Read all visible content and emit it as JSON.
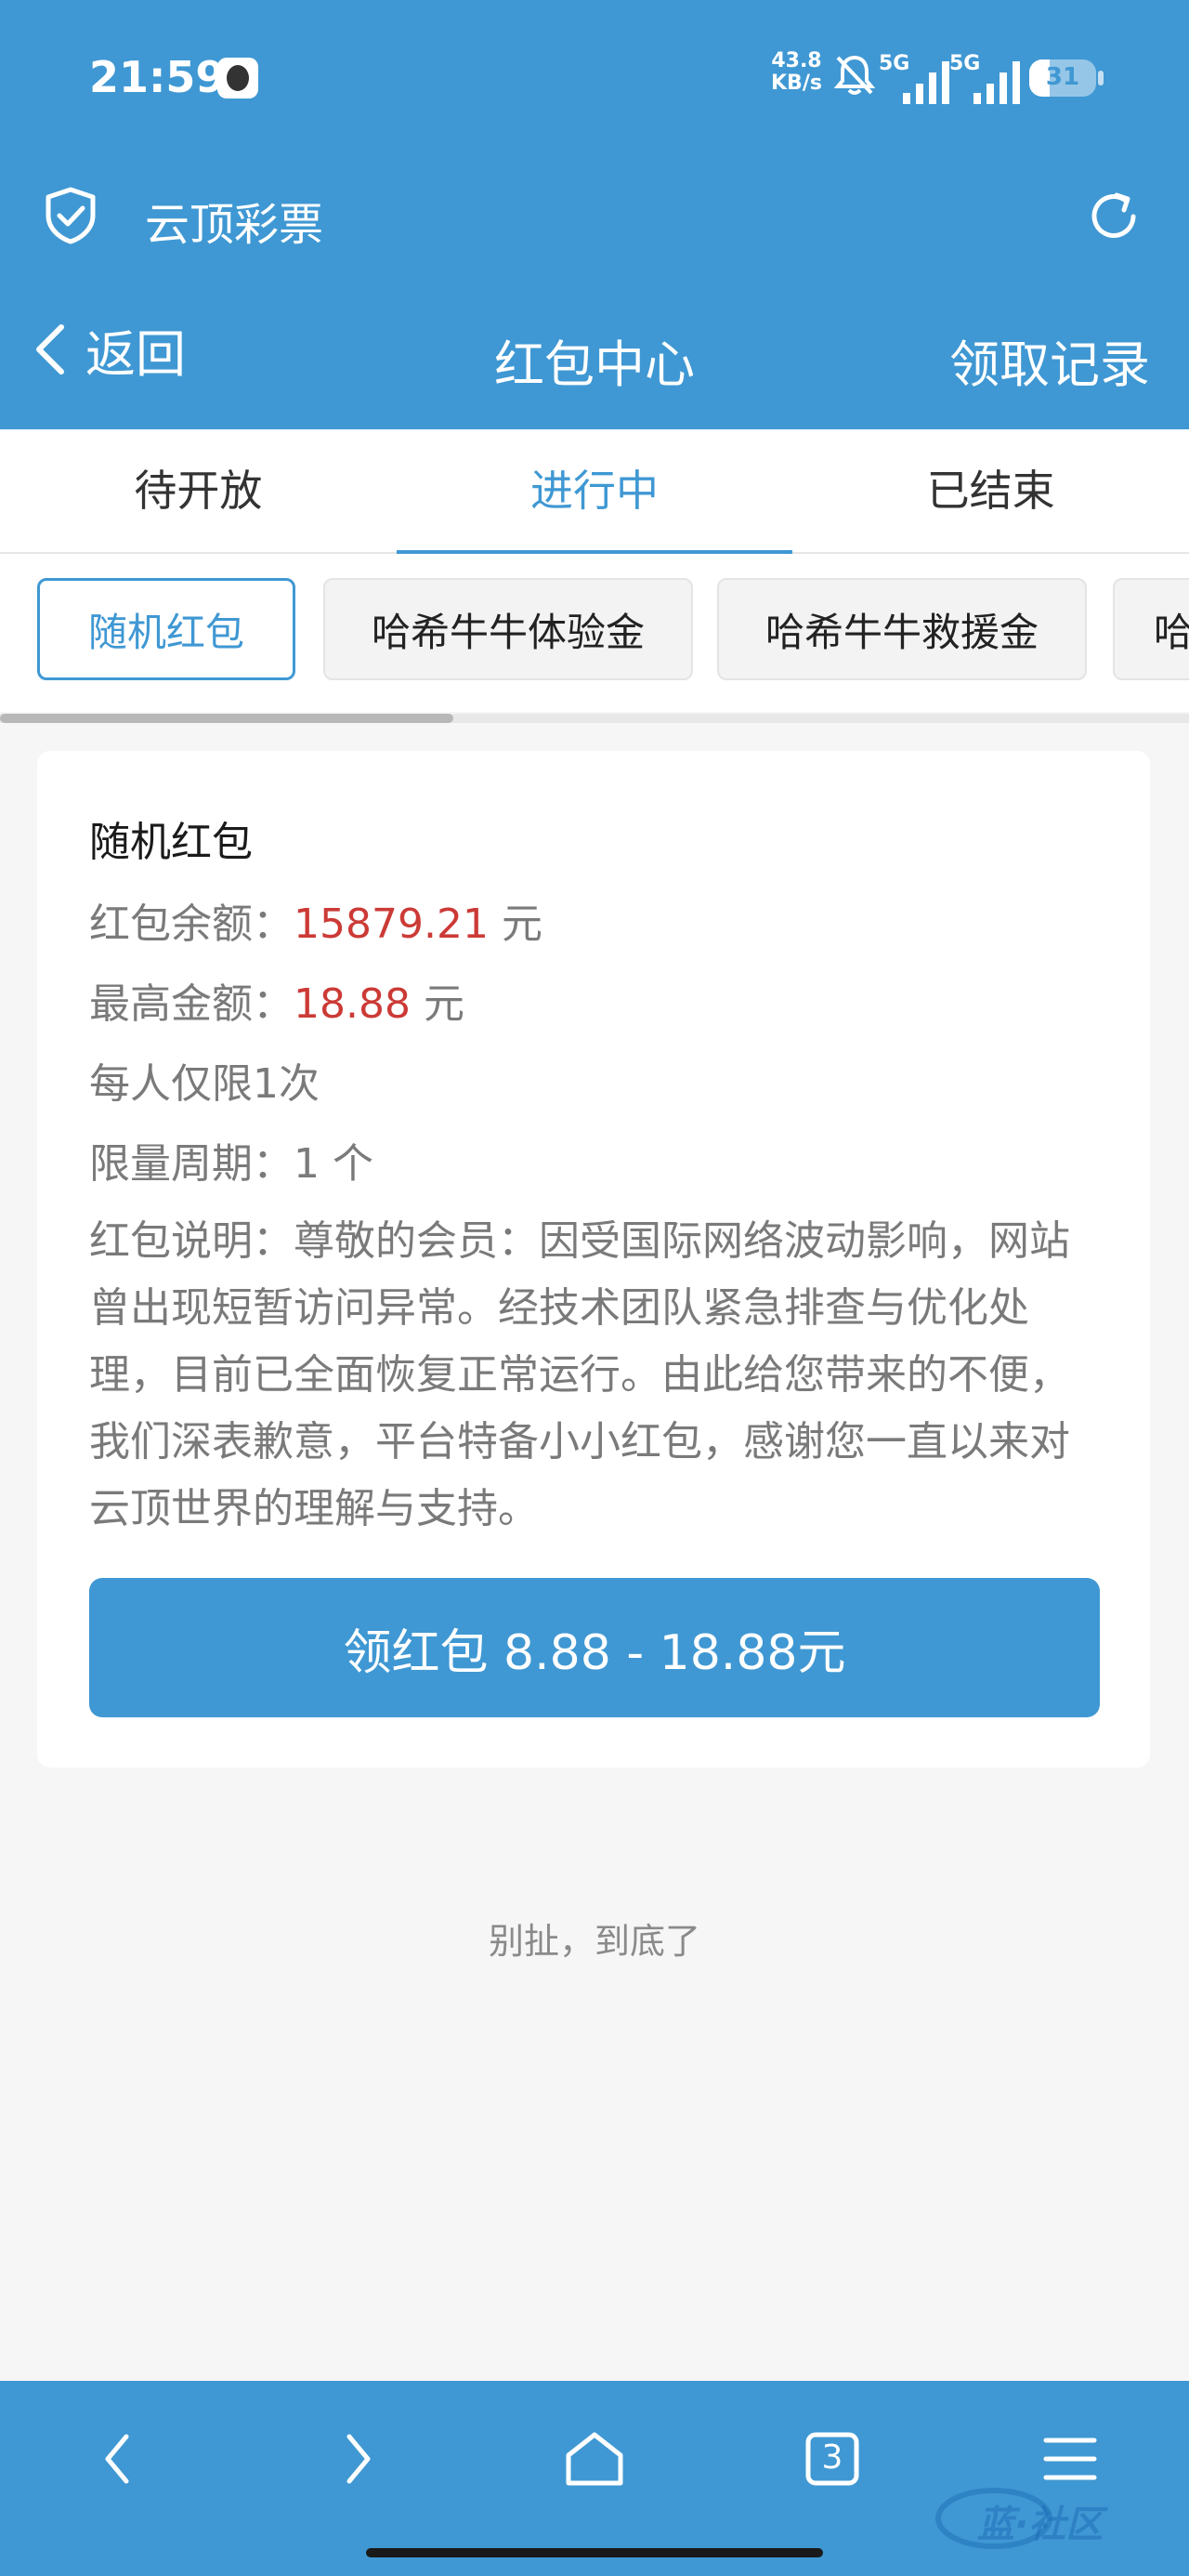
{
  "status_bar": {
    "time": "21:59",
    "net_speed_value": "43.8",
    "net_speed_unit": "KB/s",
    "signal_1": "5G",
    "signal_2": "5G",
    "battery": "31",
    "battery_level": 0.31
  },
  "app_bar": {
    "title": "云顶彩票",
    "shield_icon": "shield-check-icon",
    "refresh_icon": "refresh-icon"
  },
  "nav": {
    "back_label": "返回",
    "title": "红包中心",
    "records_label": "领取记录"
  },
  "tabs": [
    {
      "label": "待开放",
      "active": false
    },
    {
      "label": "进行中",
      "active": true
    },
    {
      "label": "已结束",
      "active": false
    }
  ],
  "chips": [
    {
      "label": "随机红包",
      "active": true
    },
    {
      "label": "哈希牛牛体验金",
      "active": false
    },
    {
      "label": "哈希牛牛救援金",
      "active": false
    },
    {
      "label": "哈",
      "active": false
    }
  ],
  "card": {
    "title": "随机红包",
    "balance_label": "红包余额：",
    "balance_value": "15879.21",
    "balance_unit": " 元",
    "max_label": "最高金额：",
    "max_value": "18.88",
    "max_unit": " 元",
    "limit_text": "每人仅限1次",
    "period_text": "限量周期：1 个",
    "description": "红包说明：尊敬的会员：因受国际网络波动影响，网站曾出现短暂访问异常。经技术团队紧急排查与优化处理，目前已全面恢复正常运行。由此给您带来的不便，我们深表歉意，平台特备小小红包，感谢您一直以来对云顶世界的理解与支持。",
    "claim_button": "领红包 8.88 - 18.88元"
  },
  "footer": {
    "end_text": "别扯，到底了"
  },
  "bottom_bar": {
    "tab_count": "3",
    "watermark": "蓝·社区"
  },
  "colors": {
    "brand": "#3f98d3",
    "highlight": "#cc3a36"
  }
}
